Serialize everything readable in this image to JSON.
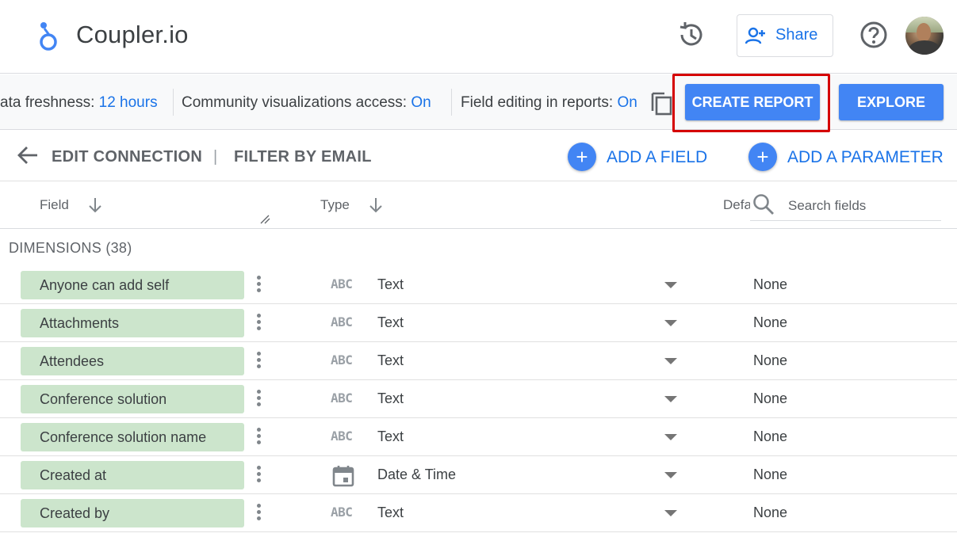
{
  "header": {
    "app_title": "Coupler.io",
    "share_label": "Share",
    "icons": [
      "coupler-logo-icon",
      "history-icon",
      "person-add-icon",
      "help-icon",
      "avatar"
    ]
  },
  "infobar": {
    "freshness_label": "ata freshness: ",
    "freshness_value": "12 hours",
    "community_label": "Community visualizations access: ",
    "community_value": "On",
    "editing_label": "Field editing in reports: ",
    "editing_value": "On",
    "create_report_label": "CREATE REPORT",
    "explore_label": "EXPLORE"
  },
  "toolbar": {
    "edit_connection": "EDIT CONNECTION",
    "separator": "|",
    "filter_by_email": "FILTER BY EMAIL",
    "add_field": "ADD A FIELD",
    "add_parameter": "ADD A PARAMETER"
  },
  "columns": {
    "field": "Field",
    "type": "Type",
    "default": "Defa",
    "search_placeholder": "Search fields"
  },
  "dimensions": {
    "title": "DIMENSIONS (38)",
    "rows": [
      {
        "name": "Anyone can add self",
        "type": "Text",
        "type_icon": "abc",
        "aggregation": "None"
      },
      {
        "name": "Attachments",
        "type": "Text",
        "type_icon": "abc",
        "aggregation": "None"
      },
      {
        "name": "Attendees",
        "type": "Text",
        "type_icon": "abc",
        "aggregation": "None"
      },
      {
        "name": "Conference solution",
        "type": "Text",
        "type_icon": "abc",
        "aggregation": "None"
      },
      {
        "name": "Conference solution name",
        "type": "Text",
        "type_icon": "abc",
        "aggregation": "None"
      },
      {
        "name": "Created at",
        "type": "Date & Time",
        "type_icon": "calendar",
        "aggregation": "None"
      },
      {
        "name": "Created by",
        "type": "Text",
        "type_icon": "abc",
        "aggregation": "None"
      }
    ],
    "abc_glyph": "ABC"
  },
  "colors": {
    "accent": "#1a73e8",
    "button_blue": "#4285f4",
    "highlight_red": "#d50000",
    "chip_green": "#cce5cc"
  }
}
